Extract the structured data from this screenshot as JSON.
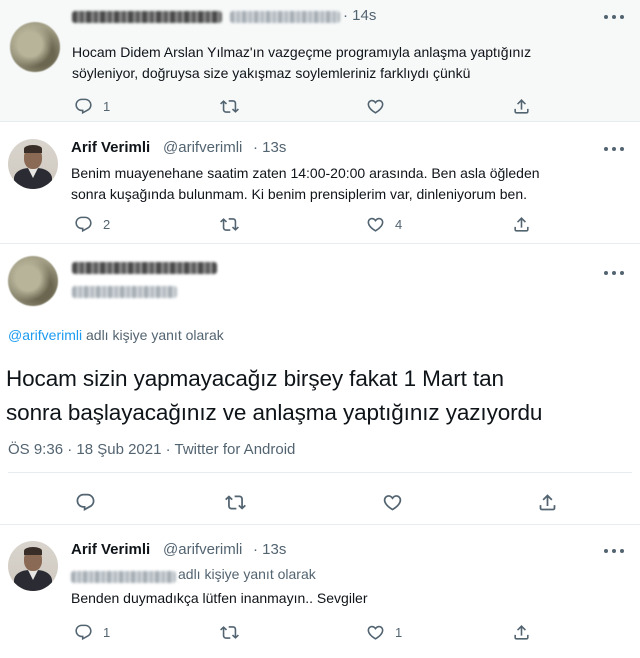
{
  "tweets": [
    {
      "time": "· 14s",
      "text_lines": [
        "Hocam Didem Arslan Yılmaz'ın vazgeçme programıyla anlaşma yaptığınız",
        "söyleniyor, doğruysa size yakışmaz soylemleriniz farklıydı çünkü"
      ],
      "reply_count": "1"
    },
    {
      "name": "Arif Verimli",
      "handle": "@arifverimli",
      "time": "· 13s",
      "text_lines": [
        "Benim muayenehane saatim zaten 14:00-20:00 arasında. Ben asla öğleden",
        "sonra kuşağında bulunmam. Ki benim prensiplerim var, dinleniyorum ben."
      ],
      "reply_count": "2",
      "like_count": "4"
    },
    {
      "reply_to_mention": "@arifverimli",
      "reply_to_suffix": " adlı kişiye yanıt olarak",
      "text_lines": [
        "Hocam sizin yapmayacağız birşey fakat 1 Mart tan",
        "sonra başlayacağınız ve anlaşma yaptığınız yazıyordu"
      ],
      "date_line": "ÖS 9:36 · 18 Şub 2021 · Twitter for Android"
    },
    {
      "name": "Arif Verimli",
      "handle": "@arifverimli",
      "time": "· 13s",
      "reply_to_suffix": " adlı kişiye yanıt olarak",
      "text_lines": [
        "Benden duymadıkça lütfen inanmayın.. Sevgiler"
      ],
      "reply_count": "1",
      "like_count": "1"
    }
  ],
  "icons": {
    "reply": "reply-icon",
    "retweet": "retweet-icon",
    "like": "heart-icon",
    "share": "share-icon",
    "more": "more-icon"
  },
  "colors": {
    "link": "#1d9bf0",
    "secondary_text": "#536471",
    "highlight_bg": "#f7f9f9"
  }
}
